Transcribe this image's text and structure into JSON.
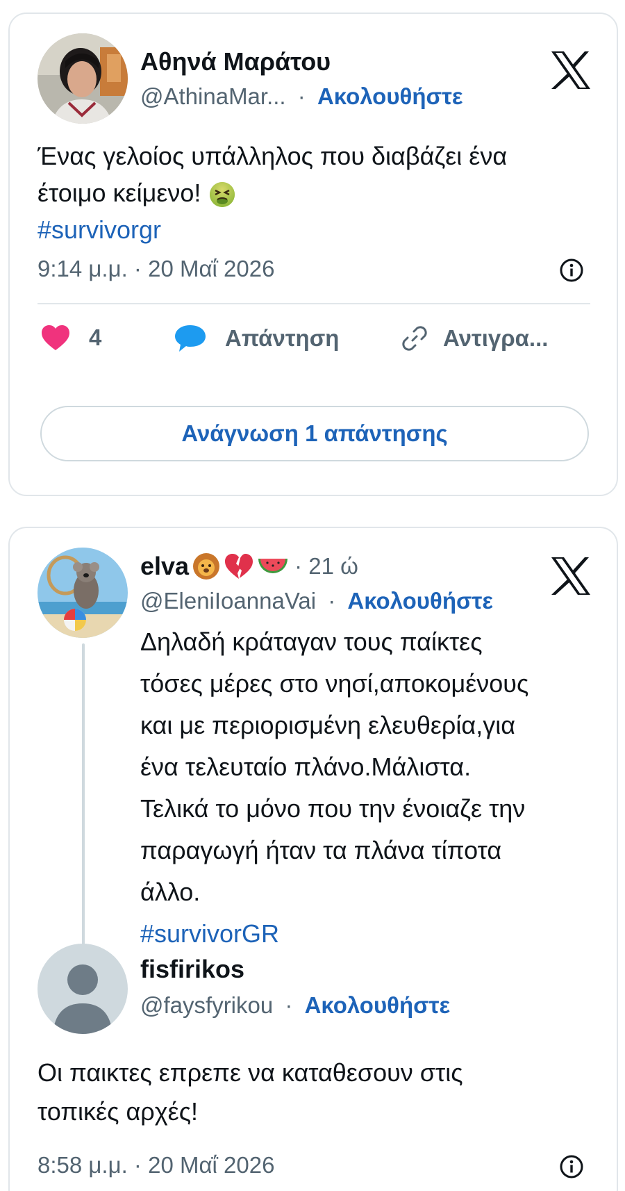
{
  "tweet1": {
    "author_name": "Αθηνά Μαράτου",
    "handle": "@AthinaMar...",
    "separator": "·",
    "follow_label": "Ακολουθήστε",
    "text_line1": "Ένας γελοίος υπάλληλος που διαβάζει ένα",
    "text_line2": "έτοιμο κείμενο!",
    "hashtag": "#survivorgr",
    "timestamp": "9:14 μ.μ. · 20 Μαΐ 2026",
    "like_count": "4",
    "reply_label": "Απάντηση",
    "copy_label": "Αντιγρα...",
    "read_replies_label": "Ανάγνωση 1 απάντησης"
  },
  "tweet2": {
    "author_name": "elva",
    "age": "· 21 ώ",
    "handle": "@EleniIoannaVai",
    "separator": "·",
    "follow_label": "Ακολουθήστε",
    "lines": [
      "Δηλαδή κράταγαν τους παίκτες",
      "τόσες μέρες στο νησί,αποκομένους",
      "και με περιορισμένη ελευθερία,για",
      "ένα τελευταίο πλάνο.Μάλιστα.",
      "Τελικά το μόνο που την ένοιαζε την",
      "παραγωγή ήταν τα πλάνα τίποτα",
      "άλλο."
    ],
    "hashtag": "#survivorGR"
  },
  "reply": {
    "author_name": "fisfirikos",
    "handle": "@faysfyrikou",
    "separator": "·",
    "follow_label": "Ακολουθήστε",
    "text_line1": "Οι παικτες επρεπε να καταθεσουν στις",
    "text_line2": "τοπικές αρχές!",
    "timestamp": "8:58 μ.μ. · 20 Μαΐ 2026"
  },
  "colors": {
    "link": "#1d63b8",
    "like": "#f0337d",
    "reply_bubble": "#1d9bf0",
    "muted": "#536471",
    "border": "#e1e6ea"
  },
  "icons": [
    "x-logo-icon",
    "heart-icon",
    "reply-bubble-icon",
    "link-icon",
    "info-icon",
    "nauseated-face-emoji",
    "lion-emoji",
    "broken-heart-emoji",
    "watermelon-emoji"
  ]
}
